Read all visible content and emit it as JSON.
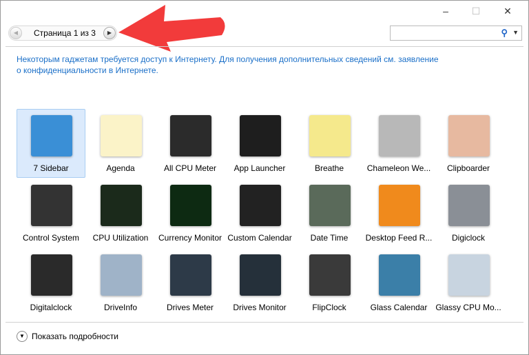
{
  "window": {
    "minimize": "–",
    "maximize": "☐",
    "close": "✕"
  },
  "nav": {
    "prev_icon": "chevron-left-icon",
    "next_icon": "chevron-right-icon",
    "page_label": "Страница 1 из 3"
  },
  "search": {
    "value": "",
    "placeholder": "",
    "icon": "search-icon"
  },
  "notice": "Некоторым гаджетам требуется доступ к Интернету. Для получения дополнительных сведений см. заявление о конфиденциальности в Интернете.",
  "annotation_arrow_color": "#f23b3b",
  "gadgets": [
    {
      "label": "7 Sidebar",
      "color": "#3a8fd6",
      "selected": true
    },
    {
      "label": "Agenda",
      "color": "#fbf3c8"
    },
    {
      "label": "All CPU Meter",
      "color": "#2b2b2b"
    },
    {
      "label": "App Launcher",
      "color": "#1e1e1e"
    },
    {
      "label": "Breathe",
      "color": "#f5e98c"
    },
    {
      "label": "Chameleon We...",
      "color": "#b8b8b8"
    },
    {
      "label": "Clipboarder",
      "color": "#e7b9a0"
    },
    {
      "label": "Control System",
      "color": "#333333"
    },
    {
      "label": "CPU Utilization",
      "color": "#1b2a1b"
    },
    {
      "label": "Currency Monitor",
      "color": "#0d2a12"
    },
    {
      "label": "Custom Calendar",
      "color": "#222222"
    },
    {
      "label": "Date Time",
      "color": "#5a6a5a"
    },
    {
      "label": "Desktop Feed R...",
      "color": "#f08a1c"
    },
    {
      "label": "Digiclock",
      "color": "#8a8f96"
    },
    {
      "label": "Digitalclock",
      "color": "#2a2a2a"
    },
    {
      "label": "DriveInfo",
      "color": "#9fb3c8"
    },
    {
      "label": "Drives Meter",
      "color": "#2d3a48"
    },
    {
      "label": "Drives Monitor",
      "color": "#25303a"
    },
    {
      "label": "FlipClock",
      "color": "#3a3a3a"
    },
    {
      "label": "Glass Calendar",
      "color": "#3b7fa8"
    },
    {
      "label": "Glassy CPU Mo...",
      "color": "#c8d4e0"
    }
  ],
  "footer": {
    "label": "Показать подробности",
    "icon": "chevron-down-icon"
  }
}
